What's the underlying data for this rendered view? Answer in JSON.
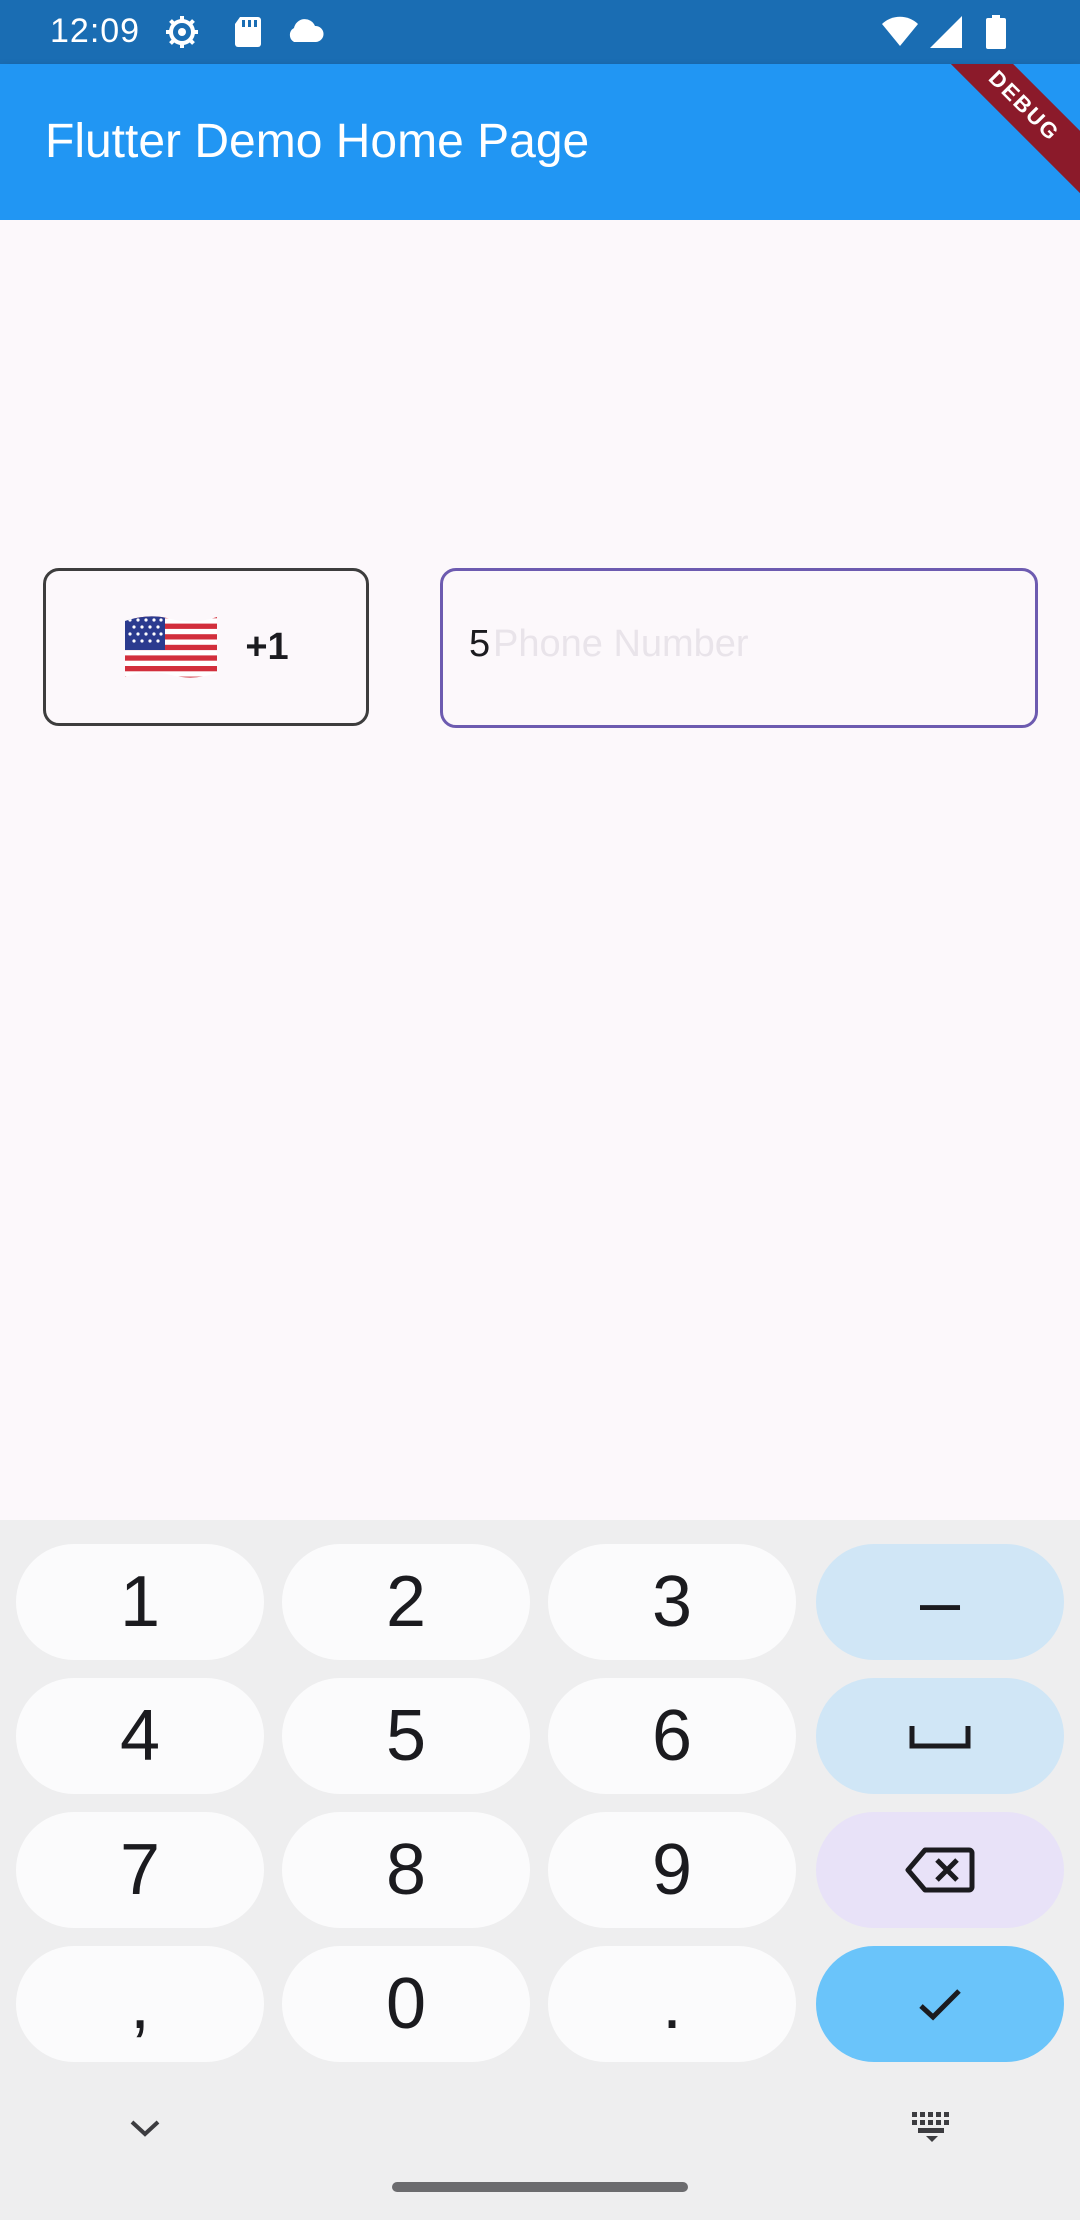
{
  "status_bar": {
    "time": "12:09",
    "icons_left": [
      "settings-gear-icon",
      "sd-card-icon",
      "cloud-icon"
    ],
    "icons_right": [
      "wifi-icon",
      "cell-signal-icon",
      "battery-icon"
    ]
  },
  "app_bar": {
    "title": "Flutter Demo Home Page",
    "debug_label": "DEBUG",
    "color": "#2196f3"
  },
  "form": {
    "country": {
      "flag": "us-flag-icon",
      "dial_code": "+1"
    },
    "phone": {
      "value": "5",
      "placeholder": "Phone Number",
      "border_color": "#6d5bb0"
    }
  },
  "keyboard": {
    "rows": [
      [
        "1",
        "2",
        "3",
        "–"
      ],
      [
        "4",
        "5",
        "6",
        "␣"
      ],
      [
        "7",
        "8",
        "9",
        "⌫"
      ],
      [
        ",",
        "0",
        ".",
        "✓"
      ]
    ],
    "nav": {
      "hide_icon": "chevron-down-icon",
      "switch_icon": "keyboard-icon"
    }
  }
}
